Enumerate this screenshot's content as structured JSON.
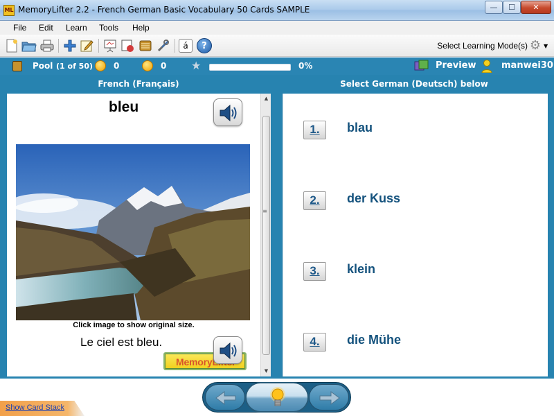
{
  "window": {
    "app_icon": "ML",
    "title": "MemoryLifter 2.2 - French German Basic Vocabulary 50 Cards SAMPLE",
    "min_glyph": "—",
    "max_glyph": "☐",
    "close_glyph": "✕"
  },
  "menu": [
    "File",
    "Edit",
    "Learn",
    "Tools",
    "Help"
  ],
  "toolbar": {
    "icons": [
      "new-document-icon",
      "open-folder-icon",
      "print-icon",
      "add-card-icon",
      "edit-card-icon",
      "presentation-icon",
      "print-cards-icon",
      "card-box-icon",
      "tools-icon",
      "special-char-icon",
      "help-icon"
    ],
    "special_char_label": "á",
    "help_label": "?",
    "select_mode_label": "Select Learning Mode(s)"
  },
  "status": {
    "pool_label": "Pool",
    "pool_count": "(1 of 50)",
    "correct_count": "0",
    "wrong_count": "0",
    "progress_percent": 0,
    "progress_label": "0%",
    "preview_label": "Preview",
    "user_name": "manwei30"
  },
  "question": {
    "header": "French (Français)",
    "word": "bleu",
    "image_hint": "Click image to show original size.",
    "example_sentence": "Le ciel est bleu.",
    "logo_text": "MemoryLifter"
  },
  "answers": {
    "header": "Select German (Deutsch) below",
    "options": [
      {
        "number": "1.",
        "text": "blau"
      },
      {
        "number": "2.",
        "text": "der Kuss"
      },
      {
        "number": "3.",
        "text": "klein"
      },
      {
        "number": "4.",
        "text": "die Mühe"
      }
    ]
  },
  "footer": {
    "card_stack_link": "Show Card Stack"
  },
  "colors": {
    "accent_blue": "#2783b0",
    "answer_text": "#14527d"
  }
}
